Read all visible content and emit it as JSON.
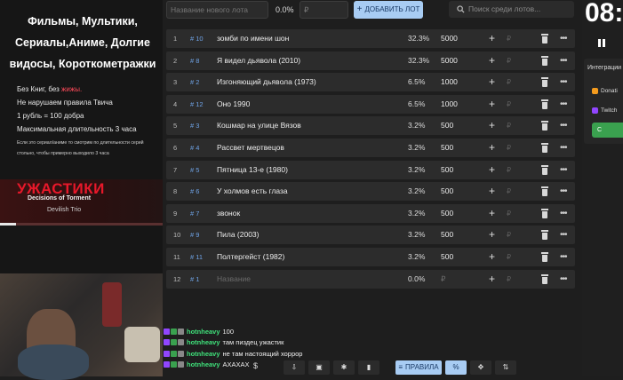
{
  "promo": {
    "title_lines": [
      "Фильмы, Мультики,",
      "Сериалы,Аниме, Долгие",
      "видосы, Короткометражки"
    ],
    "rules": [
      "Без Книг, без жижы.",
      "Не нарушаем правила Твича",
      "1 рубль = 100 добра",
      "Максимальная длительность 3 часа"
    ],
    "note_lines": [
      "Если это сериал/аниме то смотрим по длительности серий",
      "стольно, чтобы примерно выходило 3 часа"
    ],
    "now_playing": {
      "title": "УЖАСТИКИ",
      "subtitle": "Decisions of Torment",
      "artist": "Devilish Trio",
      "progress": 0.1
    }
  },
  "toolbar_top": {
    "new_lot_placeholder": "Название нового лота",
    "percent": "0.0%",
    "currency": "₽",
    "add_lot_label": "ДОБАВИТЬ ЛОТ",
    "search_placeholder": "Поиск среди лотов..."
  },
  "lots": [
    {
      "idx": "1",
      "num": "# 10",
      "name": "зомби по имени шон",
      "pct": "32.3%",
      "amount": "5000"
    },
    {
      "idx": "2",
      "num": "# 8",
      "name": "Я видел дьявола (2010)",
      "pct": "32.3%",
      "amount": "5000"
    },
    {
      "idx": "3",
      "num": "# 2",
      "name": "Изгоняющий дьявола (1973)",
      "pct": "6.5%",
      "amount": "1000"
    },
    {
      "idx": "4",
      "num": "# 12",
      "name": "Оно  1990",
      "pct": "6.5%",
      "amount": "1000"
    },
    {
      "idx": "5",
      "num": "# 3",
      "name": "Кошмар на улице Вязов",
      "pct": "3.2%",
      "amount": "500"
    },
    {
      "idx": "6",
      "num": "# 4",
      "name": "Рассвет мертвецов",
      "pct": "3.2%",
      "amount": "500"
    },
    {
      "idx": "7",
      "num": "# 5",
      "name": "Пятница 13-е (1980)",
      "pct": "3.2%",
      "amount": "500"
    },
    {
      "idx": "8",
      "num": "# 6",
      "name": "У холмов есть глаза",
      "pct": "3.2%",
      "amount": "500"
    },
    {
      "idx": "9",
      "num": "# 7",
      "name": "звонок",
      "pct": "3.2%",
      "amount": "500"
    },
    {
      "idx": "10",
      "num": "# 9",
      "name": "Пила (2003)",
      "pct": "3.2%",
      "amount": "500"
    },
    {
      "idx": "11",
      "num": "# 11",
      "name": "Полтергейст (1982)",
      "pct": "3.2%",
      "amount": "500"
    },
    {
      "idx": "12",
      "num": "# 1",
      "name": "Название",
      "pct": "0.0%",
      "amount": "₽",
      "empty": true
    }
  ],
  "row_labels": {
    "plus": "+",
    "currency": "₽",
    "more": "•••"
  },
  "right": {
    "clock": "08:",
    "integrations_title": "Интеграции",
    "items": [
      "Donati",
      "Twitch"
    ],
    "green_button": "С"
  },
  "chat": [
    {
      "user": "hotnheavy",
      "message": "100"
    },
    {
      "user": "hotnheavy",
      "message": "там пиздец ужастик"
    },
    {
      "user": "hotnheavy",
      "message": "не там настоящий хоррор"
    },
    {
      "user": "hotnheavy",
      "message": "АХАХАХ"
    }
  ],
  "toolbar_bottom": {
    "currency_symbol": "$",
    "rules_label": "ПРАВИЛА",
    "percent_symbol": "%"
  },
  "colors": {
    "accent": "#a8ccf3",
    "row_bg": "#2c2c2c",
    "num_blue": "#6fa3e6",
    "chat_user": "#3fe07a",
    "scary_red": "#e8182a"
  }
}
